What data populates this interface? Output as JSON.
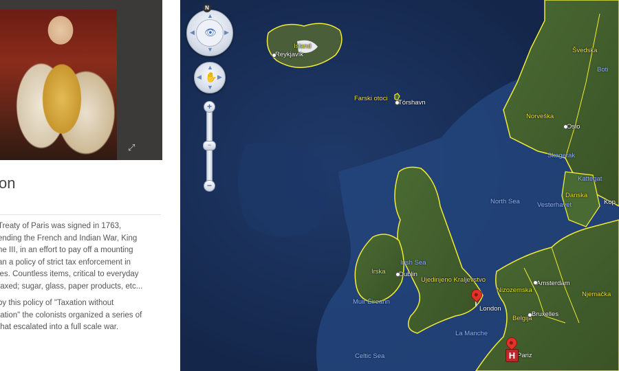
{
  "panel": {
    "title": "on",
    "paragraphs": [
      [
        "Treaty of Paris was signed in 1763,",
        "ending the French and Indian War, King",
        "ne III, in an effort to pay off a mounting",
        "an a policy of strict tax enforcement in",
        "ies. Countless items, critical to everyday",
        "taxed; sugar, glass, paper products, etc..."
      ],
      [
        "by this policy of \"Taxation without",
        "tation\" the colonists organized a series of",
        "that escalated into a full scale war."
      ]
    ],
    "expand_icon": "expand-icon"
  },
  "map": {
    "compass_label": "N",
    "zoom_plus": "+",
    "zoom_minus": "−",
    "labels": {
      "island": "Island",
      "reykjavik": "Reykjavík",
      "farski_otoci": "Farski otoci",
      "torshavn": "Tórshavn",
      "svedska": "Švedska",
      "bothnian": "Boti",
      "norveska": "Norveška",
      "oslo": "Oslo",
      "skagerrak": "Skagerak",
      "kattegat": "Kattegat",
      "danska": "Danska",
      "kopenhagen": "Kop",
      "north_sea": "North Sea",
      "vesterhavet": "Vesterhavet",
      "irish_sea": "Irish Sea",
      "irska": "Irska",
      "dublin": "Dublin",
      "uk": "Ujedinjeno Kraljevstvo",
      "muir_eireann": "Muir Éireann",
      "amsterdam": "Amsterdam",
      "nizozemska": "Nizozemska",
      "njemacka": "Njemačka",
      "london": "London",
      "belgija": "Belgija",
      "bruxelles": "Bruxelles",
      "la_manche": "La Manche",
      "celtic_sea": "Celtic Sea",
      "pariz": "Pariz"
    },
    "colors": {
      "ocean": "#172c55",
      "land": "#3d5a2a",
      "border": "#f2ec36",
      "pin": "#e0332a"
    }
  }
}
